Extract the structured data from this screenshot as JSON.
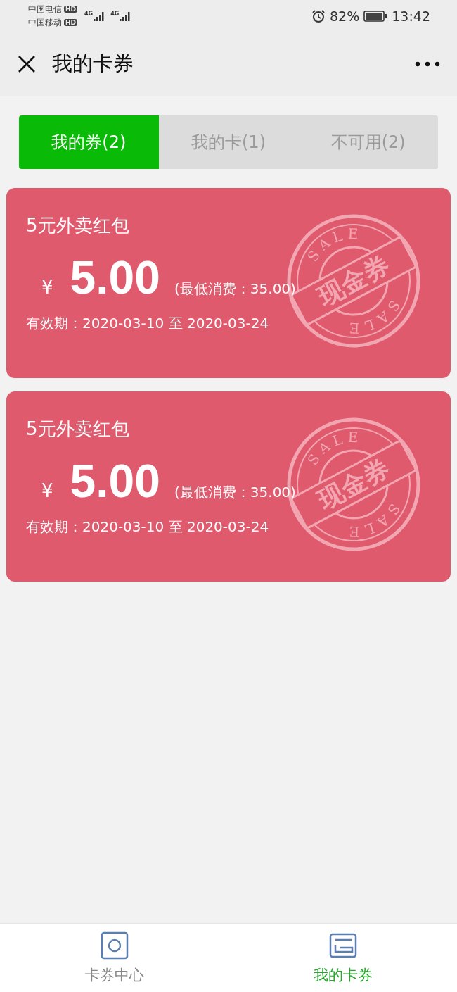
{
  "status_bar": {
    "carriers": [
      {
        "name": "中国电信",
        "badge": "HD"
      },
      {
        "name": "中国移动",
        "badge": "HD"
      }
    ],
    "network": [
      "4G",
      "4G"
    ],
    "battery_text": "82%",
    "time": "13:42"
  },
  "header": {
    "title": "我的卡券"
  },
  "tabs": [
    {
      "label": "我的券(2)",
      "selected": true
    },
    {
      "label": "我的卡(1)",
      "selected": false
    },
    {
      "label": "不可用(2)",
      "selected": false
    }
  ],
  "coupons": [
    {
      "name": "5元外卖红包",
      "currency": "¥",
      "amount": "5.00",
      "condition": "(最低消费：35.00)",
      "validity": "有效期：2020-03-10 至 2020-03-24",
      "stamp": {
        "ring_top": "SALE",
        "label": "现金券",
        "ring_bottom": "SALE"
      }
    },
    {
      "name": "5元外卖红包",
      "currency": "¥",
      "amount": "5.00",
      "condition": "(最低消费：35.00)",
      "validity": "有效期：2020-03-10 至 2020-03-24",
      "stamp": {
        "ring_top": "SALE",
        "label": "现金券",
        "ring_bottom": "SALE"
      }
    }
  ],
  "bottom_nav": [
    {
      "label": "卡券中心",
      "kind": "center",
      "selected": false
    },
    {
      "label": "我的卡券",
      "kind": "mine",
      "selected": true
    }
  ]
}
